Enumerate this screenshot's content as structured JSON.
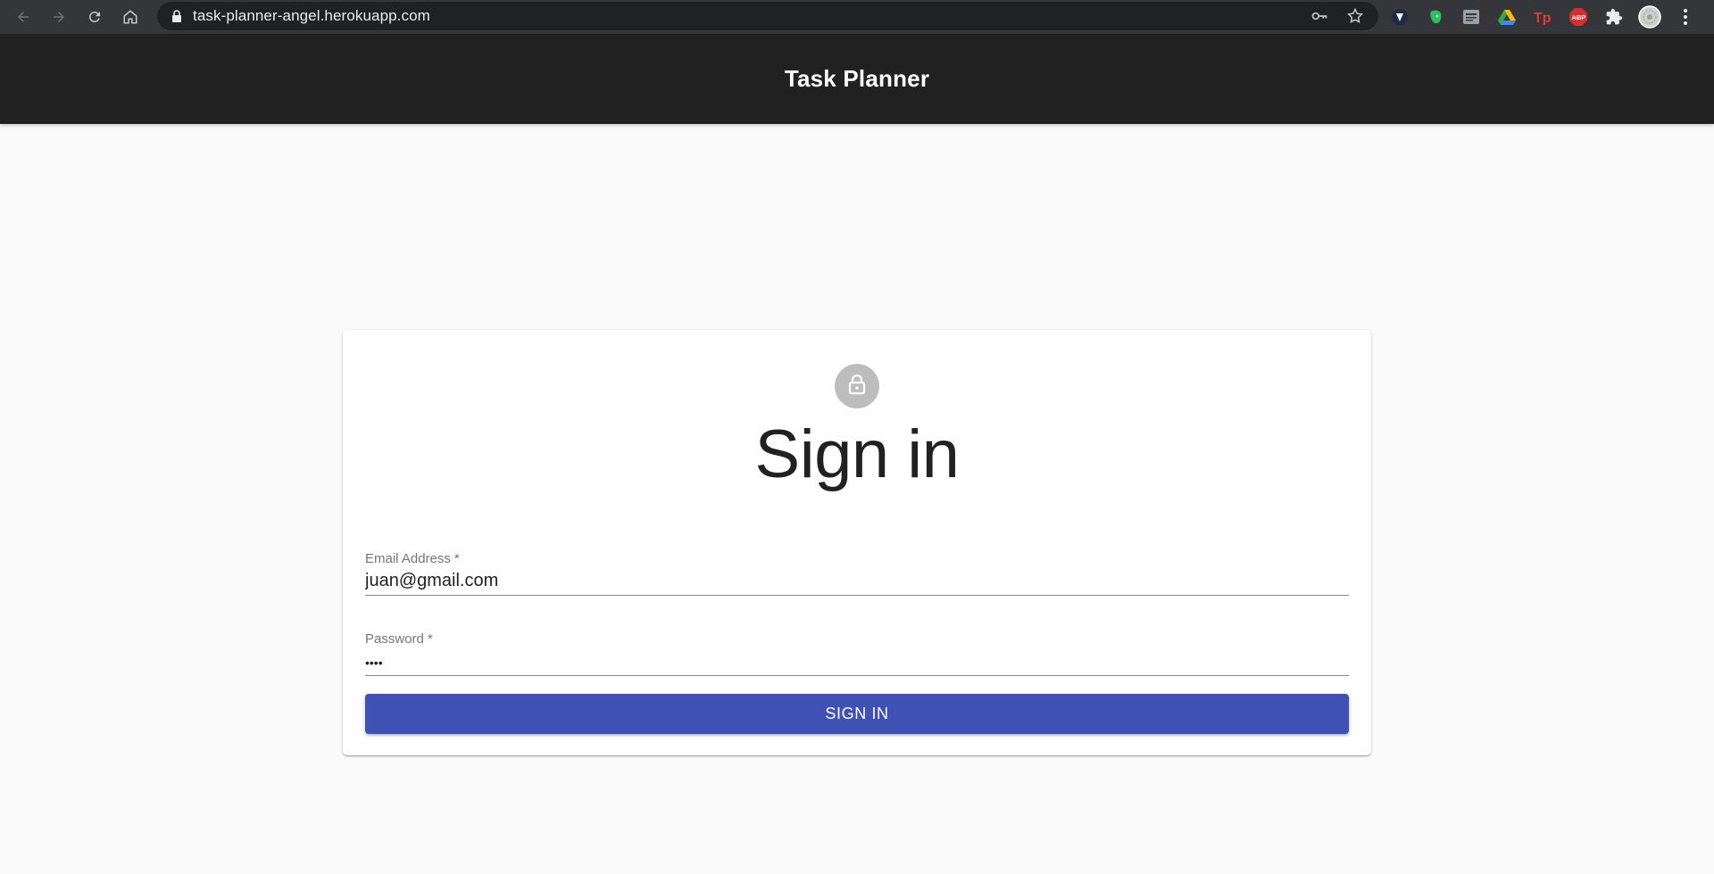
{
  "browser": {
    "url": "task-planner-angel.herokuapp.com",
    "nav_icons": [
      "back-icon",
      "forward-icon",
      "reload-icon",
      "home-icon"
    ],
    "omnibox_icons": [
      "key-icon",
      "star-icon"
    ],
    "extensions": [
      {
        "name": "shield-extension-icon",
        "color": "#1f2a44"
      },
      {
        "name": "evernote-extension-icon",
        "color": "#2dbe60"
      },
      {
        "name": "reader-extension-icon",
        "color": "#9aa0a6"
      },
      {
        "name": "drive-extension-icon",
        "color": "#fbbc04"
      },
      {
        "name": "tp-extension-icon",
        "color": "#e53935",
        "label": "Tp"
      },
      {
        "name": "adblock-extension-icon",
        "color": "#d32f2f",
        "label": "ABP"
      },
      {
        "name": "puzzle-extensions-icon",
        "color": "#e8eaed"
      },
      {
        "name": "profile-avatar-icon",
        "color": "#cfcfcf"
      },
      {
        "name": "menu-kebab-icon",
        "color": "#e8eaed"
      }
    ]
  },
  "app": {
    "title": "Task Planner",
    "header_color": "#212121"
  },
  "signin": {
    "avatar_icon": "lock-icon",
    "title": "Sign in",
    "email_label": "Email Address *",
    "email_value": "juan@gmail.com",
    "password_label": "Password *",
    "password_masked": "••••",
    "button_label": "SIGN IN",
    "button_color": "#3f51b5"
  }
}
